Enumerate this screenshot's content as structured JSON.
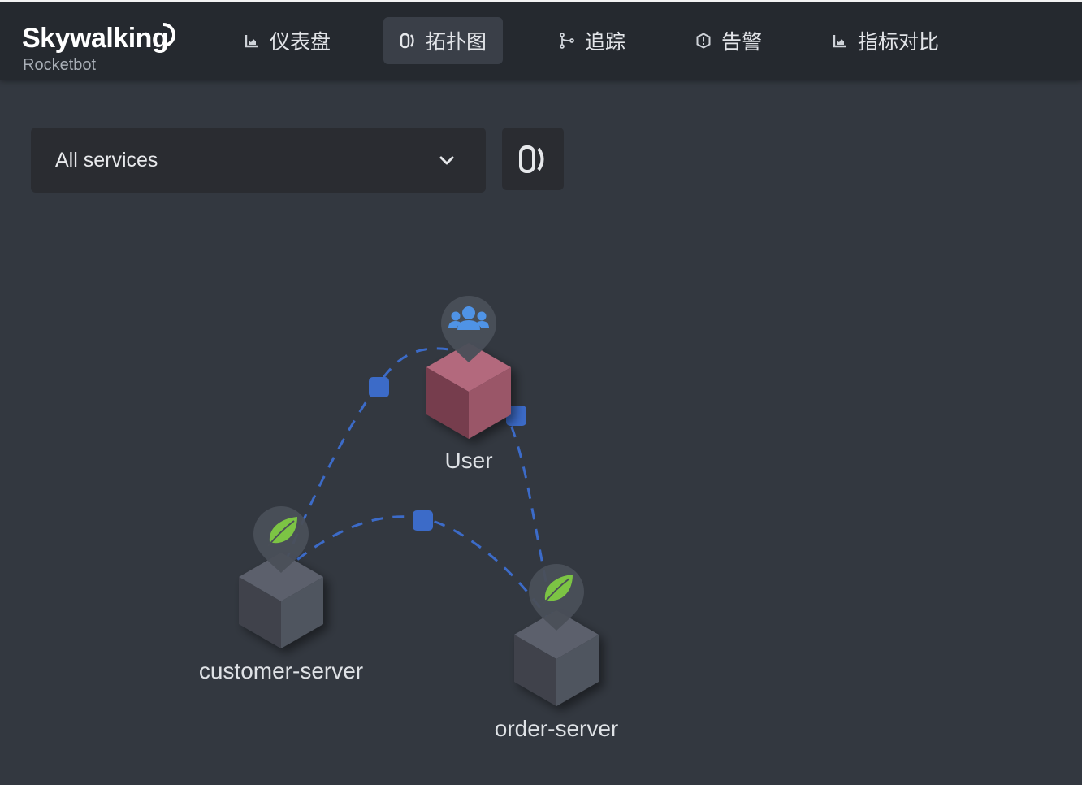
{
  "header": {
    "brand": "Skywalking",
    "subtitle": "Rocketbot",
    "nav": [
      {
        "label": "仪表盘",
        "icon": "chart-icon",
        "active": false
      },
      {
        "label": "拓扑图",
        "icon": "topology-icon",
        "active": true
      },
      {
        "label": "追踪",
        "icon": "trace-icon",
        "active": false
      },
      {
        "label": "告警",
        "icon": "alarm-icon",
        "active": false
      },
      {
        "label": "指标对比",
        "icon": "chart-icon",
        "active": false
      }
    ]
  },
  "toolbar": {
    "service_select": "All services",
    "topology_button_icon": "topology-icon"
  },
  "topology": {
    "nodes": [
      {
        "name": "User",
        "icon": "users-icon",
        "color": "#8a4a5e"
      },
      {
        "name": "customer-server",
        "icon": "spring-leaf-icon",
        "color": "#4b4f59"
      },
      {
        "name": "order-server",
        "icon": "spring-leaf-icon",
        "color": "#4b4f59"
      }
    ],
    "edges": [
      {
        "from": "User",
        "to": "customer-server"
      },
      {
        "from": "User",
        "to": "order-server"
      },
      {
        "from": "customer-server",
        "to": "order-server"
      }
    ],
    "edge_color": "#3c6bc8",
    "pin_color": "#4a4f58"
  }
}
